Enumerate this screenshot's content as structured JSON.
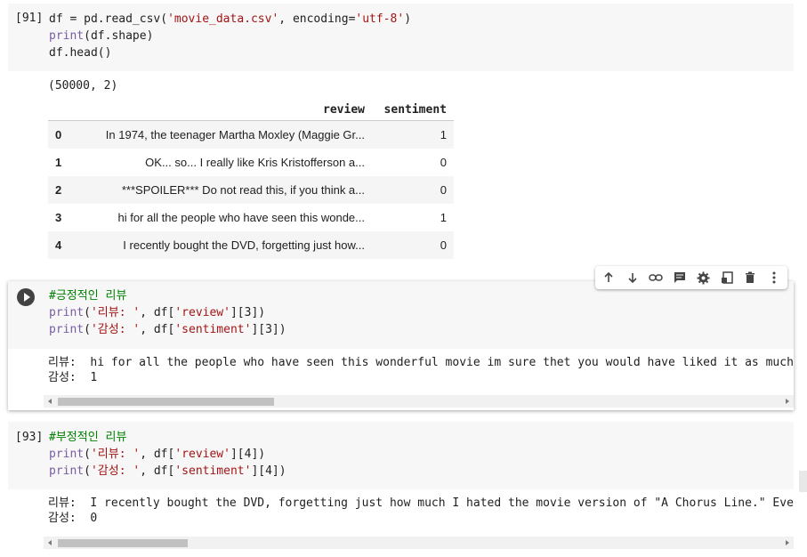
{
  "cell91": {
    "exec_count": "[91]",
    "line1_a": "df = pd.read_csv(",
    "line1_b": "'movie_data.csv'",
    "line1_c": ", encoding=",
    "line1_d": "'utf-8'",
    "line1_e": ")",
    "line2_a": "print",
    "line2_b": "(df.shape)",
    "line3": "df.head()",
    "shape_output": "(50000, 2)",
    "table": {
      "headers": [
        "review",
        "sentiment"
      ],
      "rows": [
        {
          "idx": "0",
          "review": "In 1974, the teenager Martha Moxley (Maggie Gr...",
          "sentiment": "1"
        },
        {
          "idx": "1",
          "review": "OK... so... I really like Kris Kristofferson a...",
          "sentiment": "0"
        },
        {
          "idx": "2",
          "review": "***SPOILER*** Do not read this, if you think a...",
          "sentiment": "0"
        },
        {
          "idx": "3",
          "review": "hi for all the people who have seen this wonde...",
          "sentiment": "1"
        },
        {
          "idx": "4",
          "review": "I recently bought the DVD, forgetting just how...",
          "sentiment": "0"
        }
      ]
    }
  },
  "toolbar": {
    "icons": [
      "arrow-up-icon",
      "arrow-down-icon",
      "link-icon",
      "comment-icon",
      "gear-icon",
      "mirror-cell-icon",
      "delete-icon",
      "more-vert-icon"
    ]
  },
  "cell_active": {
    "comment": "#긍정적인 리뷰",
    "line2_a": "print",
    "line2_b": "(",
    "line2_c": "'리뷰: '",
    "line2_d": ", df[",
    "line2_e": "'review'",
    "line2_f": "][3])",
    "line3_a": "print",
    "line3_b": "(",
    "line3_c": "'감성: '",
    "line3_d": ", df[",
    "line3_e": "'sentiment'",
    "line3_f": "][3])",
    "out_line1": "리뷰:  hi for all the people who have seen this wonderful movie im sure thet you would have liked it as much as i. i lov",
    "out_line2": "감성:  1",
    "scroll_fraction": 0.3
  },
  "cell93": {
    "exec_count": "[93]",
    "comment": "#부정적인 리뷰",
    "line2_a": "print",
    "line2_b": "(",
    "line2_c": "'리뷰: '",
    "line2_d": ", df[",
    "line2_e": "'review'",
    "line2_f": "][4])",
    "line3_a": "print",
    "line3_b": "(",
    "line3_c": "'감성: '",
    "line3_d": ", df[",
    "line3_e": "'sentiment'",
    "line3_f": "][4])",
    "out_line1": "리뷰:  I recently bought the DVD, forgetting just how much I hated the movie version of \"A Chorus Line.\" Every change th",
    "out_line2": "감성:  0",
    "scroll_fraction": 0.18
  }
}
